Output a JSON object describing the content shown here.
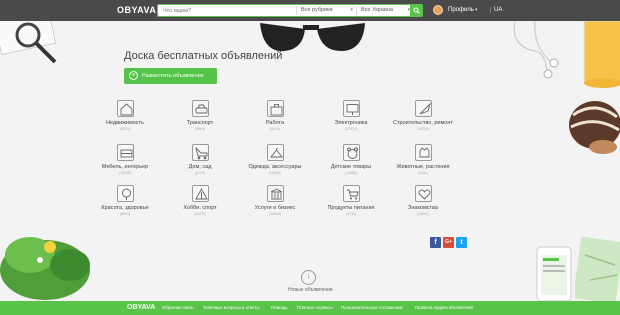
{
  "header": {
    "logo": "OBYAVA",
    "search_placeholder": "Что ищем?",
    "category_select": "Все рубрики",
    "region_select": "Все Украина",
    "profile_label": "Профиль",
    "language": "UA"
  },
  "main": {
    "title": "Доска бесплатных объявлений",
    "post_button": "Разместить объявление",
    "categories": [
      {
        "name": "Недвижимость",
        "count": "(8001)",
        "icon": "house-icon"
      },
      {
        "name": "Транспорт",
        "count": "(4963)",
        "icon": "car-icon"
      },
      {
        "name": "Работа",
        "count": "(4475)",
        "icon": "briefcase-icon"
      },
      {
        "name": "Электроника",
        "count": "(17013)",
        "icon": "monitor-icon"
      },
      {
        "name": "Строительство, ремонт",
        "count": "(16210)",
        "icon": "trowel-icon"
      },
      {
        "name": "Мебель, интерьер",
        "count": "(12035)",
        "icon": "sofa-icon"
      },
      {
        "name": "Дом, сад",
        "count": "(4175)",
        "icon": "lawnmower-icon"
      },
      {
        "name": "Одежда, аксессуары",
        "count": "(18325)",
        "icon": "hanger-icon"
      },
      {
        "name": "Детские товары",
        "count": "(10868)",
        "icon": "toy-icon"
      },
      {
        "name": "Животные, растения",
        "count": "(6111)",
        "icon": "pet-icon"
      },
      {
        "name": "Красота, здоровье",
        "count": "(6891)",
        "icon": "mirror-icon"
      },
      {
        "name": "Хобби, спорт",
        "count": "(10570)",
        "icon": "sport-icon"
      },
      {
        "name": "Услуги и бизнес",
        "count": "(10968)",
        "icon": "bank-icon"
      },
      {
        "name": "Продукты питания",
        "count": "(4731)",
        "icon": "cart-icon"
      },
      {
        "name": "Знакомства",
        "count": "(10887)",
        "icon": "heart-icon"
      }
    ],
    "social": [
      "f",
      "G+",
      "t"
    ],
    "new_ads": "Новые объявления"
  },
  "footer": {
    "logo": "OBYAVA",
    "links": [
      "Обратная связь",
      "Типичные вопросы и ответы",
      "Помощь",
      "Платные сервисы",
      "Пользовательское соглашение",
      "Правила подачи объявлений"
    ]
  },
  "colors": {
    "accent": "#59c34a",
    "header": "#4a4a4a",
    "background": "#f3f3f3"
  }
}
